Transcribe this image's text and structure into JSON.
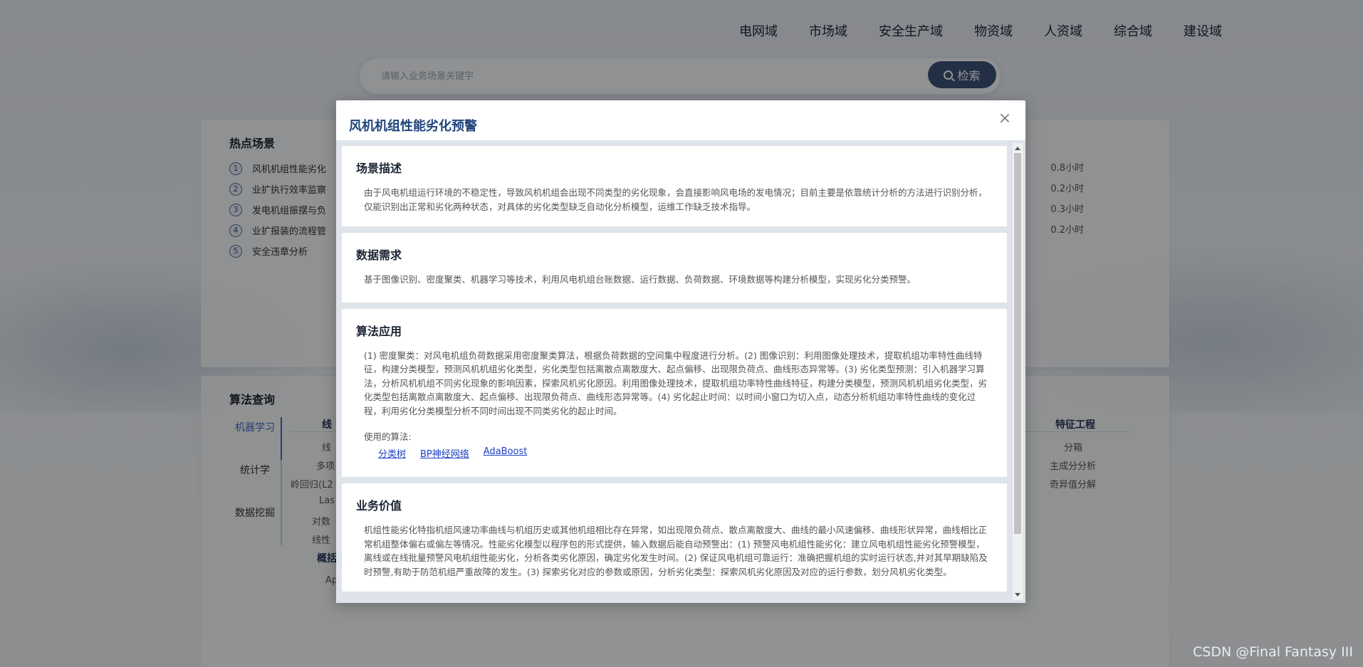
{
  "nav": [
    "电网域",
    "市场域",
    "安全生产域",
    "物资域",
    "人资域",
    "综合域",
    "建设域"
  ],
  "search": {
    "placeholder": "请输入业务场景关键字",
    "button_label": "检索"
  },
  "hot": {
    "title": "热点场景",
    "items": [
      {
        "num": "1",
        "label": "风机机组性能劣化",
        "time": "0.8小时"
      },
      {
        "num": "2",
        "label": "业扩执行效率监察",
        "time": "0.2小时"
      },
      {
        "num": "3",
        "label": "发电机组振摆与负",
        "time": "0.3小时"
      },
      {
        "num": "4",
        "label": "业扩报装的流程管",
        "time": "0.2小时"
      },
      {
        "num": "5",
        "label": "安全违章分析",
        "time": ""
      }
    ]
  },
  "algo": {
    "title": "算法查询",
    "tabs": [
      "机器学习",
      "统计学",
      "数据挖掘"
    ],
    "col1_header": "线",
    "col1_items": [
      "线",
      "多项",
      "岭回归(L2",
      "Las",
      "对数",
      "线性"
    ],
    "col1_sub_header": "概括",
    "col1_sub_items": [
      "Ap"
    ],
    "col_right_header": "特征工程",
    "col_right_items": [
      "分箱",
      "主成分分析",
      "奇异值分解"
    ]
  },
  "modal": {
    "title": "风机机组性能劣化预警",
    "sections": {
      "desc": {
        "title": "场景描述",
        "text": "由于风电机组运行环境的不稳定性，导致风机机组会出现不同类型的劣化现象，会直接影响风电场的发电情况；目前主要是依靠统计分析的方法进行识别分析，仅能识别出正常和劣化两种状态，对具体的劣化类型缺乏自动化分析模型，运维工作缺乏技术指导。"
      },
      "data": {
        "title": "数据需求",
        "text": "基于图像识别、密度聚类、机器学习等技术，利用风电机组台账数据、运行数据、负荷数据、环境数据等构建分析模型，实现劣化分类预警。"
      },
      "algorithm": {
        "title": "算法应用",
        "text": "(1) 密度聚类：对风电机组负荷数据采用密度聚类算法，根据负荷数据的空间集中程度进行分析。(2) 图像识别：利用图像处理技术，提取机组功率特性曲线特征，构建分类模型，预测风机机组劣化类型，劣化类型包括离散点离散度大、起点偏移、出现限负荷点、曲线形态异常等。(3) 劣化类型预测：引入机器学习算法，分析风机机组不同劣化现象的影响因素，探索风机劣化原因。利用图像处理技术，提取机组功率特性曲线特征，构建分类模型，预测风机机组劣化类型，劣化类型包括离散点离散度大、起点偏移、出现限负荷点、曲线形态异常等。(4) 劣化起止时间：以时间小窗口为切入点，动态分析机组功率特性曲线的变化过程，利用劣化分类模型分析不同时间出现不同类劣化的起止时间。",
        "used_label": "使用的算法:",
        "links": [
          "分类树",
          "BP神经网络",
          "AdaBoost"
        ]
      },
      "value": {
        "title": "业务价值",
        "text": "机组性能劣化特指机组风速功率曲线与机组历史或其他机组相比存在异常，如出现限负荷点、散点离散度大、曲线的最小风速偏移、曲线形状异常，曲线相比正常机组整体偏右或偏左等情况。性能劣化模型以程序包的形式提供，输入数据后能自动预警出：(1) 预警风电机组性能劣化：建立风电机组性能劣化预警模型，离线或在线批量预警风电机组性能劣化，分析各类劣化原因，确定劣化发生时间。(2) 保证风电机组可靠运行：准确把握机组的实时运行状态,并对其早期缺陷及时预警,有助于防范机组严重故障的发生。(3) 探索劣化对应的参数或原因，分析劣化类型：探索风机劣化原因及对应的运行参数，划分风机劣化类型。"
      }
    }
  },
  "watermark": "CSDN @Final Fantasy III"
}
